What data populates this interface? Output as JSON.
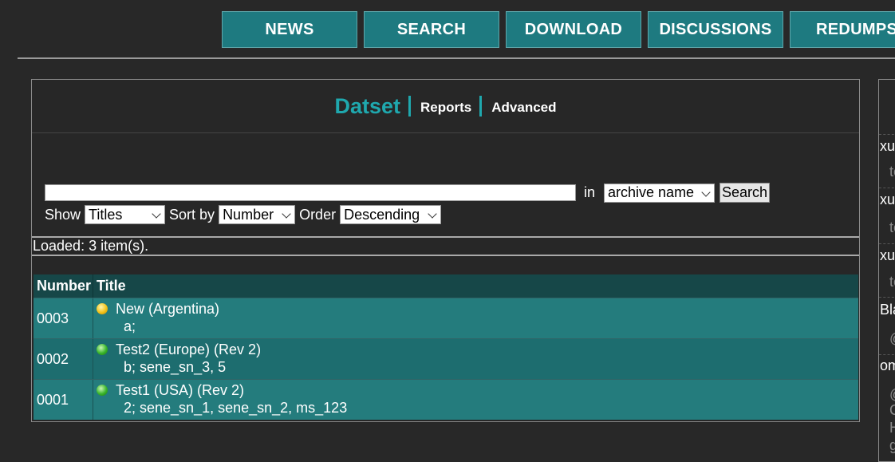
{
  "nav": {
    "items": [
      "NEWS",
      "SEARCH",
      "DOWNLOAD",
      "DISCUSSIONS",
      "REDUMPS"
    ],
    "bg_color": "#1e7a80"
  },
  "panel": {
    "tabs": {
      "active": "Datset",
      "reports": "Reports",
      "advanced": "Advanced"
    },
    "accent_color": "#1fa8ae",
    "search": {
      "input_value": "",
      "in_label": "in",
      "field_select": "archive name",
      "button": "Search"
    },
    "options": {
      "show_label": "Show",
      "show_value": "Titles",
      "sort_label": "Sort by",
      "sort_value": "Number",
      "order_label": "Order",
      "order_value": "Descending"
    },
    "loaded_text": "Loaded: 3 item(s).",
    "table": {
      "columns": [
        "Number",
        "Title"
      ],
      "rows": [
        {
          "number": "0003",
          "title": "New (Argentina)",
          "sub": "a;",
          "status": "yellow"
        },
        {
          "number": "0002",
          "title": "Test2 (Europe) (Rev 2)",
          "sub": "b; sene_sn_3, 5",
          "status": "green"
        },
        {
          "number": "0001",
          "title": "Test1 (USA) (Rev 2)",
          "sub": "2; sene_sn_1, sene_sn_2, ms_123",
          "status": "green"
        }
      ]
    }
  },
  "side": {
    "items": [
      {
        "label": "xu",
        "sub": "te"
      },
      {
        "label": "xu",
        "sub": "te"
      },
      {
        "label": "xu",
        "sub": "te"
      },
      {
        "label": "Bla",
        "sub": "@"
      },
      {
        "label": "om",
        "sub": "@"
      }
    ],
    "extra": [
      "C",
      "H",
      "g"
    ]
  }
}
